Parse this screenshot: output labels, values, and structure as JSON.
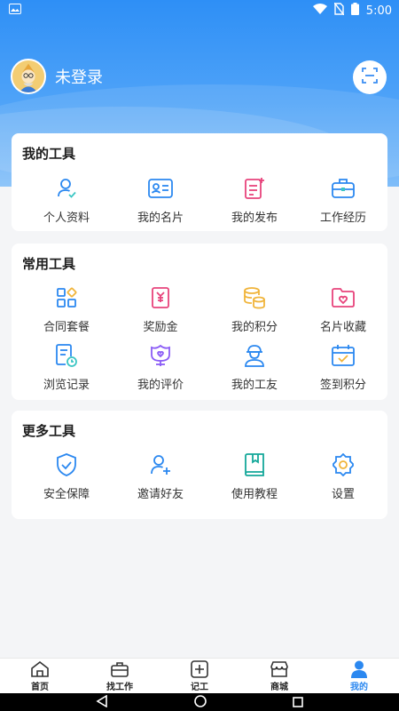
{
  "status_bar": {
    "time": "5:00"
  },
  "profile": {
    "login_status": "未登录"
  },
  "colors": {
    "primary": "#2e8ff6",
    "active_tab": "#2b88f0"
  },
  "sections": {
    "my_tools": {
      "title": "我的工具",
      "items": [
        {
          "label": "个人资料",
          "icon": "user-check-icon"
        },
        {
          "label": "我的名片",
          "icon": "id-card-icon"
        },
        {
          "label": "我的发布",
          "icon": "publish-doc-icon"
        },
        {
          "label": "工作经历",
          "icon": "briefcase-icon"
        }
      ]
    },
    "common_tools": {
      "title": "常用工具",
      "items": [
        {
          "label": "合同套餐",
          "icon": "grid-apps-icon"
        },
        {
          "label": "奖励金",
          "icon": "reward-money-icon"
        },
        {
          "label": "我的积分",
          "icon": "coins-icon"
        },
        {
          "label": "名片收藏",
          "icon": "folder-heart-icon"
        },
        {
          "label": "浏览记录",
          "icon": "history-doc-icon"
        },
        {
          "label": "我的评价",
          "icon": "flower-heart-icon"
        },
        {
          "label": "我的工友",
          "icon": "worker-icon"
        },
        {
          "label": "签到积分",
          "icon": "calendar-check-icon"
        }
      ]
    },
    "more_tools": {
      "title": "更多工具",
      "items": [
        {
          "label": "安全保障",
          "icon": "shield-check-icon"
        },
        {
          "label": "邀请好友",
          "icon": "user-plus-icon"
        },
        {
          "label": "使用教程",
          "icon": "book-icon"
        },
        {
          "label": "设置",
          "icon": "gear-icon"
        }
      ]
    }
  },
  "tab_bar": {
    "items": [
      {
        "label": "首页",
        "icon": "home-icon"
      },
      {
        "label": "找工作",
        "icon": "briefcase-icon"
      },
      {
        "label": "记工",
        "icon": "plus-square-icon"
      },
      {
        "label": "商城",
        "icon": "store-icon"
      },
      {
        "label": "我的",
        "icon": "person-icon",
        "active": true
      }
    ]
  }
}
